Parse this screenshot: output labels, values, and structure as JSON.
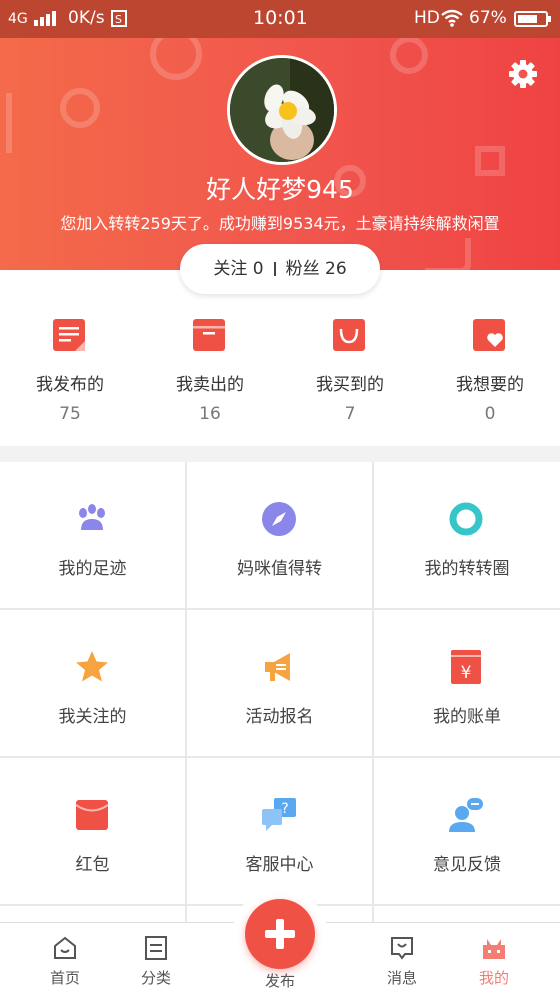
{
  "status_bar": {
    "network": "4G",
    "speed": "0K/s",
    "time": "10:01",
    "hd": "HD",
    "battery": "67%"
  },
  "profile": {
    "nickname": "好人好梦945",
    "slogan": "您加入转转259天了。成功赚到9534元，土豪请持续解救闲置",
    "follow_label": "关注",
    "follow_count": "0",
    "fans_label": "粉丝",
    "fans_count": "26"
  },
  "stats": [
    {
      "label": "我发布的",
      "count": "75"
    },
    {
      "label": "我卖出的",
      "count": "16"
    },
    {
      "label": "我买到的",
      "count": "7"
    },
    {
      "label": "我想要的",
      "count": "0"
    }
  ],
  "menu": [
    {
      "label": "我的足迹",
      "icon": "paw-icon",
      "color": "#8b86ea"
    },
    {
      "label": "妈咪值得转",
      "icon": "compass-icon",
      "color": "#8b86ea"
    },
    {
      "label": "我的转转圈",
      "icon": "ring-icon",
      "color": "#36c6c9"
    },
    {
      "label": "我关注的",
      "icon": "star-icon",
      "color": "#f7a340"
    },
    {
      "label": "活动报名",
      "icon": "megaphone-icon",
      "color": "#f7a340"
    },
    {
      "label": "我的账单",
      "icon": "bill-icon",
      "color": "#f05145"
    },
    {
      "label": "红包",
      "icon": "red-packet-icon",
      "color": "#f05145"
    },
    {
      "label": "客服中心",
      "icon": "customer-service-icon",
      "color": "#5aa9f0"
    },
    {
      "label": "意见反馈",
      "icon": "feedback-icon",
      "color": "#5aa9f0"
    }
  ],
  "tabs": [
    {
      "label": "首页",
      "icon": "home-icon"
    },
    {
      "label": "分类",
      "icon": "category-icon"
    },
    {
      "label": "发布",
      "icon": "publish-plus-icon"
    },
    {
      "label": "消息",
      "icon": "message-icon"
    },
    {
      "label": "我的",
      "icon": "mine-icon",
      "active": true
    }
  ],
  "colors": {
    "accent": "#f05145",
    "header_start": "#f46a4a",
    "header_end": "#ef4343",
    "active_tab": "#f57e74"
  }
}
